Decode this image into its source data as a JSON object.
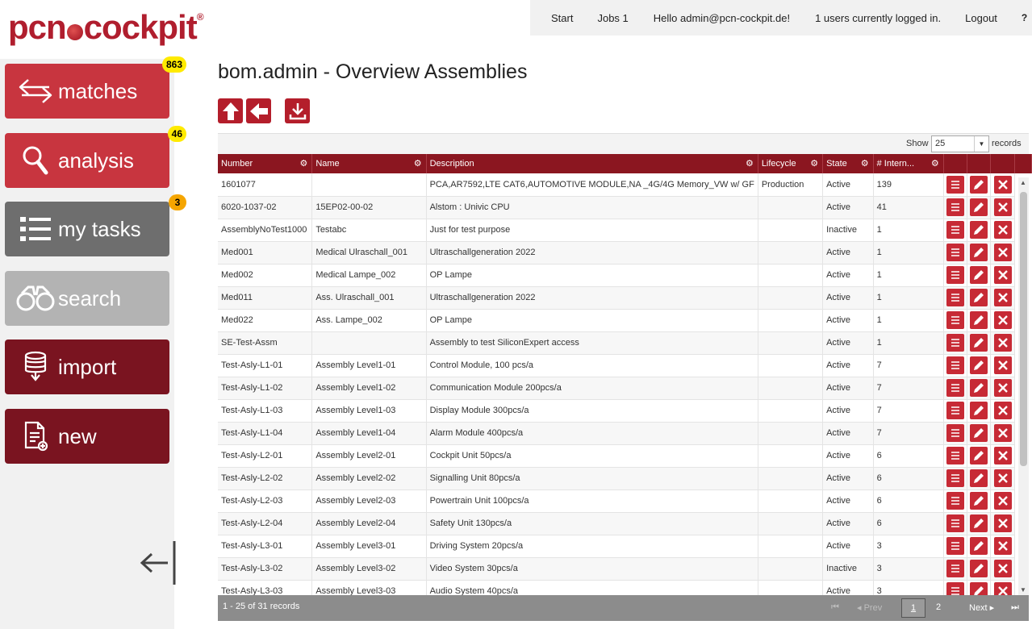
{
  "logo": {
    "text_a": "pcn",
    "text_b": "cockpit",
    "reg": "®"
  },
  "topnav": {
    "start": "Start",
    "jobs": "Jobs 1",
    "hello": "Hello admin@pcn-cockpit.de!",
    "users": "1 users currently logged in.",
    "logout": "Logout",
    "help": "?"
  },
  "sidebar": {
    "matches": {
      "label": "matches",
      "badge": "863"
    },
    "analysis": {
      "label": "analysis",
      "badge": "46"
    },
    "tasks": {
      "label": "my tasks",
      "badge": "3"
    },
    "search": {
      "label": "search"
    },
    "import": {
      "label": "import"
    },
    "new": {
      "label": "new"
    }
  },
  "page": {
    "title": "bom.admin - Overview Assemblies"
  },
  "table_controls": {
    "show_label": "Show",
    "page_size": "25",
    "records_label": "records"
  },
  "table": {
    "columns": [
      "Number",
      "Name",
      "Description",
      "Lifecycle",
      "State",
      "# Intern..."
    ],
    "rows": [
      [
        "1601077",
        "",
        "PCA,AR7592,LTE CAT6,AUTOMOTIVE MODULE,NA _4G/4G Memory_VW w/ GF",
        "Production",
        "Active",
        "139"
      ],
      [
        "6020-1037-02",
        "15EP02-00-02",
        "Alstom : Univic CPU",
        "",
        "Active",
        "41"
      ],
      [
        "AssemblyNoTest1000",
        "Testabc",
        "Just for test purpose",
        "",
        "Inactive",
        "1"
      ],
      [
        "Med001",
        "Medical Ulraschall_001",
        "Ultraschallgeneration 2022",
        "",
        "Active",
        "1"
      ],
      [
        "Med002",
        "Medical Lampe_002",
        "OP Lampe",
        "",
        "Active",
        "1"
      ],
      [
        "Med011",
        "Ass. Ulraschall_001",
        "Ultraschallgeneration 2022",
        "",
        "Active",
        "1"
      ],
      [
        "Med022",
        "Ass. Lampe_002",
        "OP Lampe",
        "",
        "Active",
        "1"
      ],
      [
        "SE-Test-Assm",
        "",
        "Assembly to test SiliconExpert access",
        "",
        "Active",
        "1"
      ],
      [
        "Test-Asly-L1-01",
        "Assembly Level1-01",
        "Control Module, 100 pcs/a",
        "",
        "Active",
        "7"
      ],
      [
        "Test-Asly-L1-02",
        "Assembly Level1-02",
        "Communication Module 200pcs/a",
        "",
        "Active",
        "7"
      ],
      [
        "Test-Asly-L1-03",
        "Assembly Level1-03",
        "Display Module 300pcs/a",
        "",
        "Active",
        "7"
      ],
      [
        "Test-Asly-L1-04",
        "Assembly Level1-04",
        "Alarm Module 400pcs/a",
        "",
        "Active",
        "7"
      ],
      [
        "Test-Asly-L2-01",
        "Assembly Level2-01",
        "Cockpit Unit 50pcs/a",
        "",
        "Active",
        "6"
      ],
      [
        "Test-Asly-L2-02",
        "Assembly Level2-02",
        "Signalling Unit 80pcs/a",
        "",
        "Active",
        "6"
      ],
      [
        "Test-Asly-L2-03",
        "Assembly Level2-03",
        "Powertrain Unit 100pcs/a",
        "",
        "Active",
        "6"
      ],
      [
        "Test-Asly-L2-04",
        "Assembly Level2-04",
        "Safety Unit 130pcs/a",
        "",
        "Active",
        "6"
      ],
      [
        "Test-Asly-L3-01",
        "Assembly Level3-01",
        "Driving System 20pcs/a",
        "",
        "Active",
        "3"
      ],
      [
        "Test-Asly-L3-02",
        "Assembly Level3-02",
        "Video System 30pcs/a",
        "",
        "Inactive",
        "3"
      ],
      [
        "Test-Asly-L3-03",
        "Assembly Level3-03",
        "Audio System 40pcs/a",
        "",
        "Active",
        "3"
      ]
    ]
  },
  "footer": {
    "info": "1 - 25 of 31 records",
    "prev": "Prev",
    "page1": "1",
    "page2": "2",
    "next": "Next"
  },
  "colors": {
    "brand": "#c8353f",
    "header": "#8b1620",
    "dark_tile": "#7a1420"
  }
}
